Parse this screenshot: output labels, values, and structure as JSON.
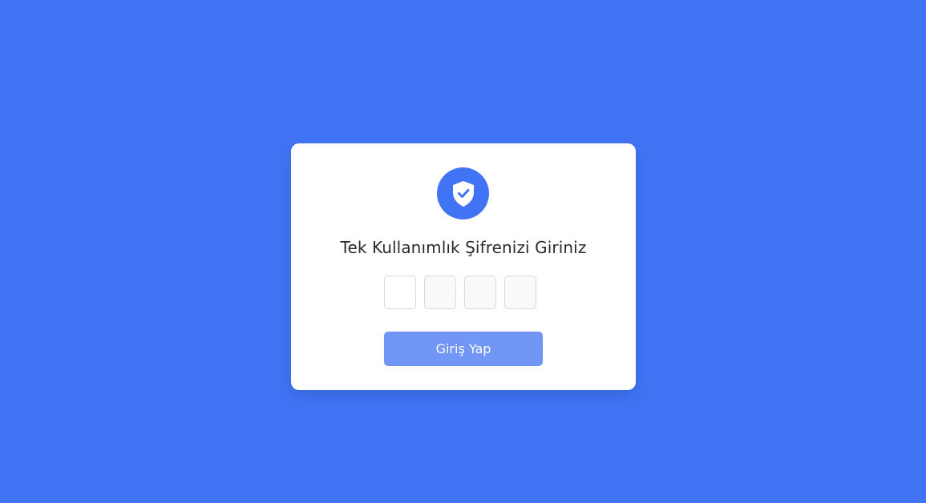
{
  "theme": {
    "background": "#4174f5",
    "card_background": "#ffffff",
    "accent": "#4174f5",
    "button_color": "#7296f6",
    "button_text_color": "#ffffff",
    "title_color": "#2b2b2b"
  },
  "card": {
    "icon": "shield-check-icon",
    "title": "Tek Kullanımlık Şifrenizi Giriniz",
    "otp_fields": [
      {
        "value": ""
      },
      {
        "value": ""
      },
      {
        "value": ""
      },
      {
        "value": ""
      }
    ],
    "submit_label": "Giriş Yap"
  }
}
